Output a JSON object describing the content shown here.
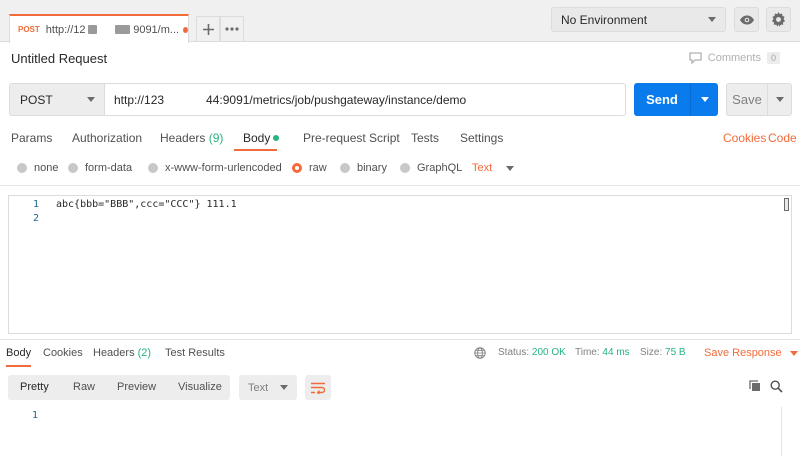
{
  "tabs": [
    {
      "method": "POST",
      "title": "http://12",
      "unsaved": false
    },
    {
      "method": "",
      "title": "9091/m...",
      "unsaved": true
    }
  ],
  "environment": {
    "selected": "No Environment"
  },
  "request": {
    "title": "Untitled Request",
    "comments_label": "Comments",
    "comments_count": "0",
    "method": "POST",
    "url_start": "http://123",
    "url_end": "44:9091/metrics/job/pushgateway/instance/demo",
    "send_label": "Send",
    "save_label": "Save"
  },
  "request_tabs": {
    "params": "Params",
    "authorization": "Authorization",
    "headers": "Headers",
    "headers_count": "(9)",
    "body": "Body",
    "prerequest": "Pre-request Script",
    "tests": "Tests",
    "settings": "Settings",
    "cookies": "Cookies",
    "code": "Code"
  },
  "body_types": {
    "none": "none",
    "form_data": "form-data",
    "urlencoded": "x-www-form-urlencoded",
    "raw": "raw",
    "binary": "binary",
    "graphql": "GraphQL",
    "text_type": "Text",
    "selected": "raw"
  },
  "editor": {
    "lines": [
      {
        "no": "1",
        "text": "abc{bbb=\"BBB\",ccc=\"CCC\"} 111.1"
      },
      {
        "no": "2",
        "text": ""
      }
    ]
  },
  "response": {
    "tabs": {
      "body": "Body",
      "cookies": "Cookies",
      "headers": "Headers",
      "headers_count": "(2)",
      "test_results": "Test Results"
    },
    "status_label": "Status:",
    "status_value": "200 OK",
    "time_label": "Time:",
    "time_value": "44 ms",
    "size_label": "Size:",
    "size_value": "75 B",
    "save_response": "Save Response",
    "views": {
      "pretty": "Pretty",
      "raw": "Raw",
      "preview": "Preview",
      "visualize": "Visualize"
    },
    "format": "Text",
    "line_no": "1"
  },
  "colors": {
    "accent": "#f26b3a",
    "send": "#097bed",
    "success": "#26b47f"
  }
}
